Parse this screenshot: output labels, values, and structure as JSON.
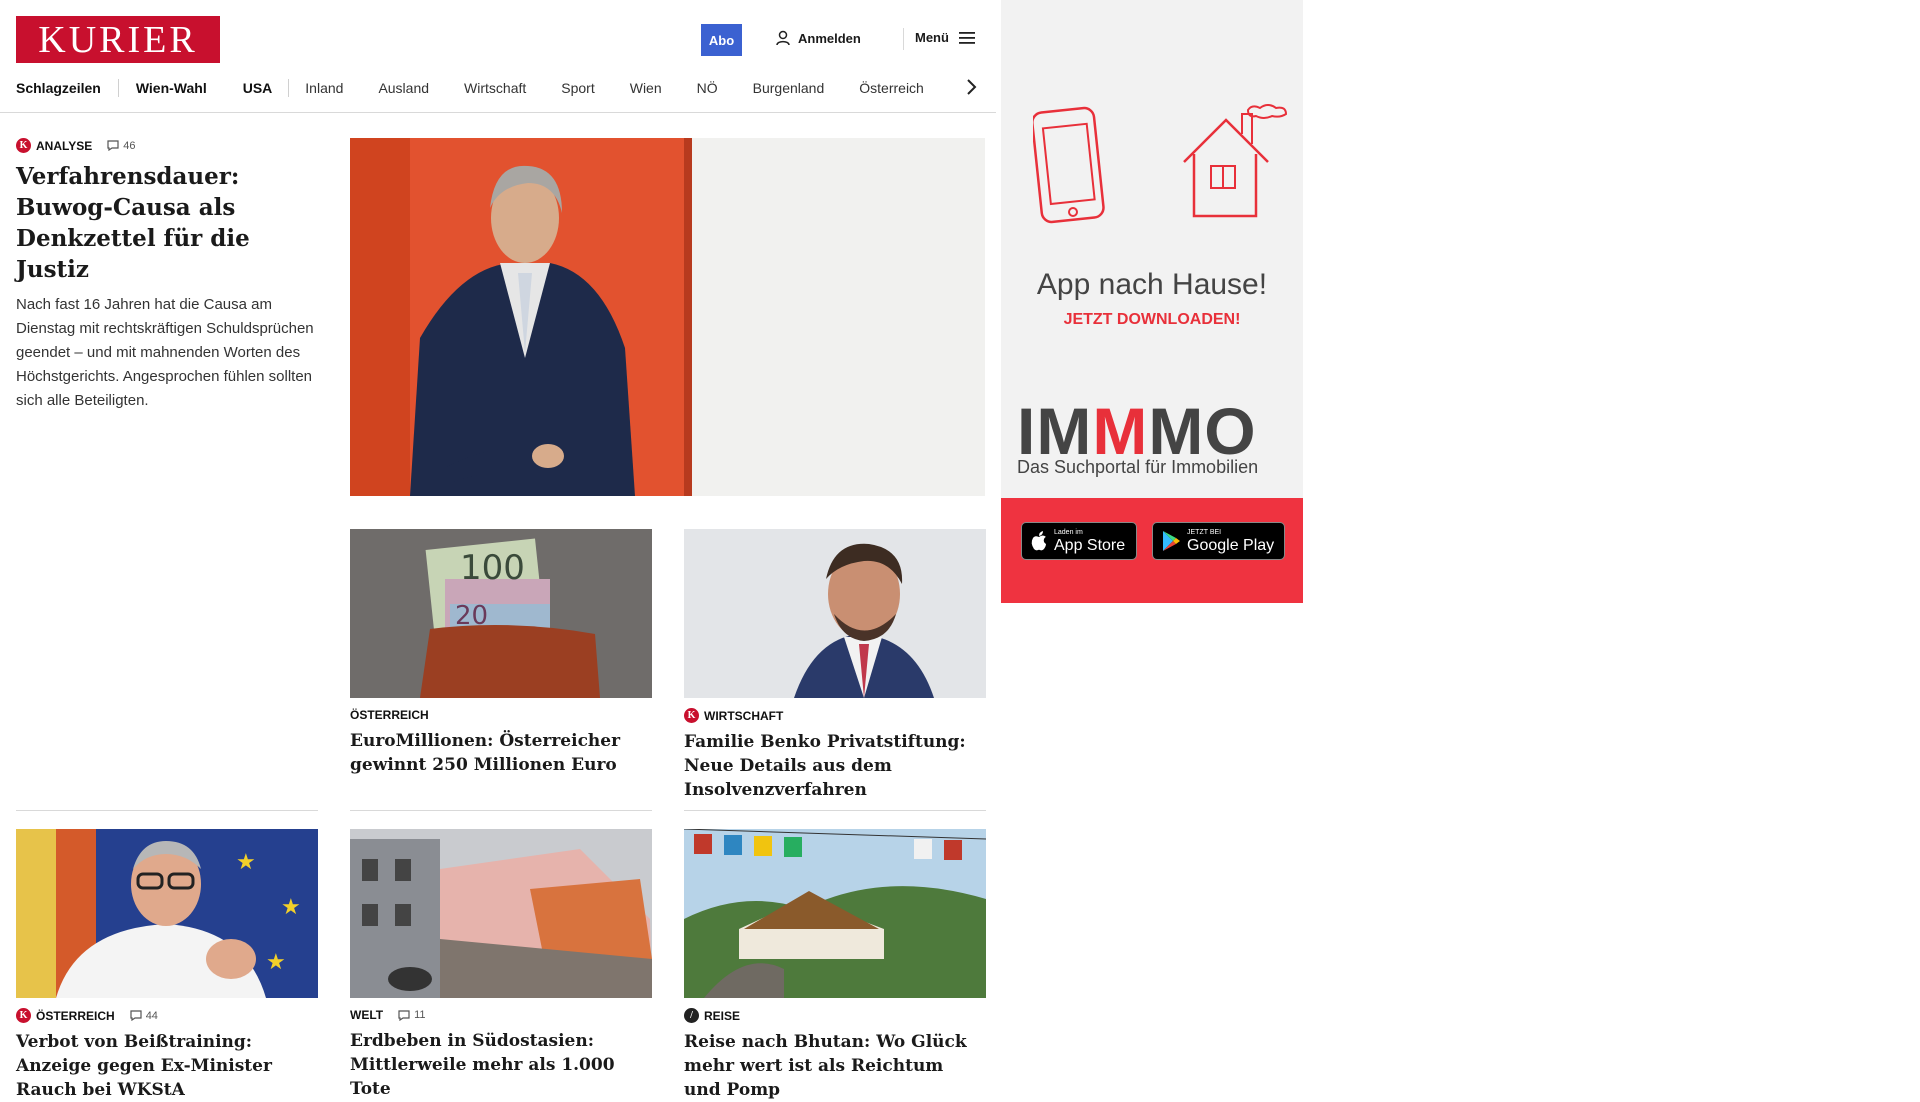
{
  "header": {
    "logo_text": "KURIER",
    "abo_label": "Abo",
    "login_label": "Anmelden",
    "menu_label": "Menü"
  },
  "nav": {
    "items": [
      "Schlagzeilen",
      "Wien-Wahl",
      "USA",
      "Inland",
      "Ausland",
      "Wirtschaft",
      "Sport",
      "Wien",
      "NÖ",
      "Burgenland",
      "Österreich"
    ]
  },
  "lead": {
    "kicker": "ANALYSE",
    "comments": "46",
    "title": "Verfahrensdauer: Buwog-Causa als Denkzettel für die Justiz",
    "teaser": "Nach fast 16 Jahren hat die Causa am Dienstag mit rechtskräftigen Schuldsprüchen geendet – und mit mahnenden Worten des Höchstgerichts. Angesprochen fühlen sollten sich alle Beteiligten."
  },
  "cards_row1": [
    {
      "kicker": "ÖSTERREICH",
      "title": "EuroMillionen: Österreicher gewinnt 250 Millionen Euro"
    },
    {
      "kicker": "WIRTSCHAFT",
      "title": "Familie Benko Privatstiftung: Neue Details aus dem Insolvenzverfahren"
    }
  ],
  "cards_row2": [
    {
      "kicker": "ÖSTERREICH",
      "comments": "44",
      "title": "Verbot von Beißtraining: Anzeige gegen Ex-Minister Rauch bei WKStA"
    },
    {
      "kicker": "WELT",
      "comments": "11",
      "title": "Erdbeben in Südostasien: Mittlerweile mehr als 1.000 Tote"
    },
    {
      "kicker": "REISE",
      "title": "Reise nach Bhutan: Wo Glück mehr wert ist als Reichtum und Pomp"
    }
  ],
  "ad": {
    "headline": "App nach Hause!",
    "subline": "JETZT DOWNLOADEN!",
    "brand_left": "IM",
    "brand_mid": "M",
    "brand_right": "MO",
    "brand_sub": "Das Suchportal für Immobilien",
    "appstore_small": "Laden im",
    "appstore_big": "App Store",
    "googleplay_small": "JETZT BEI",
    "googleplay_big": "Google Play"
  },
  "colors": {
    "brand_red": "#c8102e",
    "abo_blue": "#3b61d1",
    "ad_red": "#ef3340"
  },
  "icons": [
    "user-icon",
    "hamburger-icon",
    "chevron-right-icon",
    "comment-icon",
    "kurier-k-icon",
    "apple-icon",
    "google-play-icon"
  ]
}
